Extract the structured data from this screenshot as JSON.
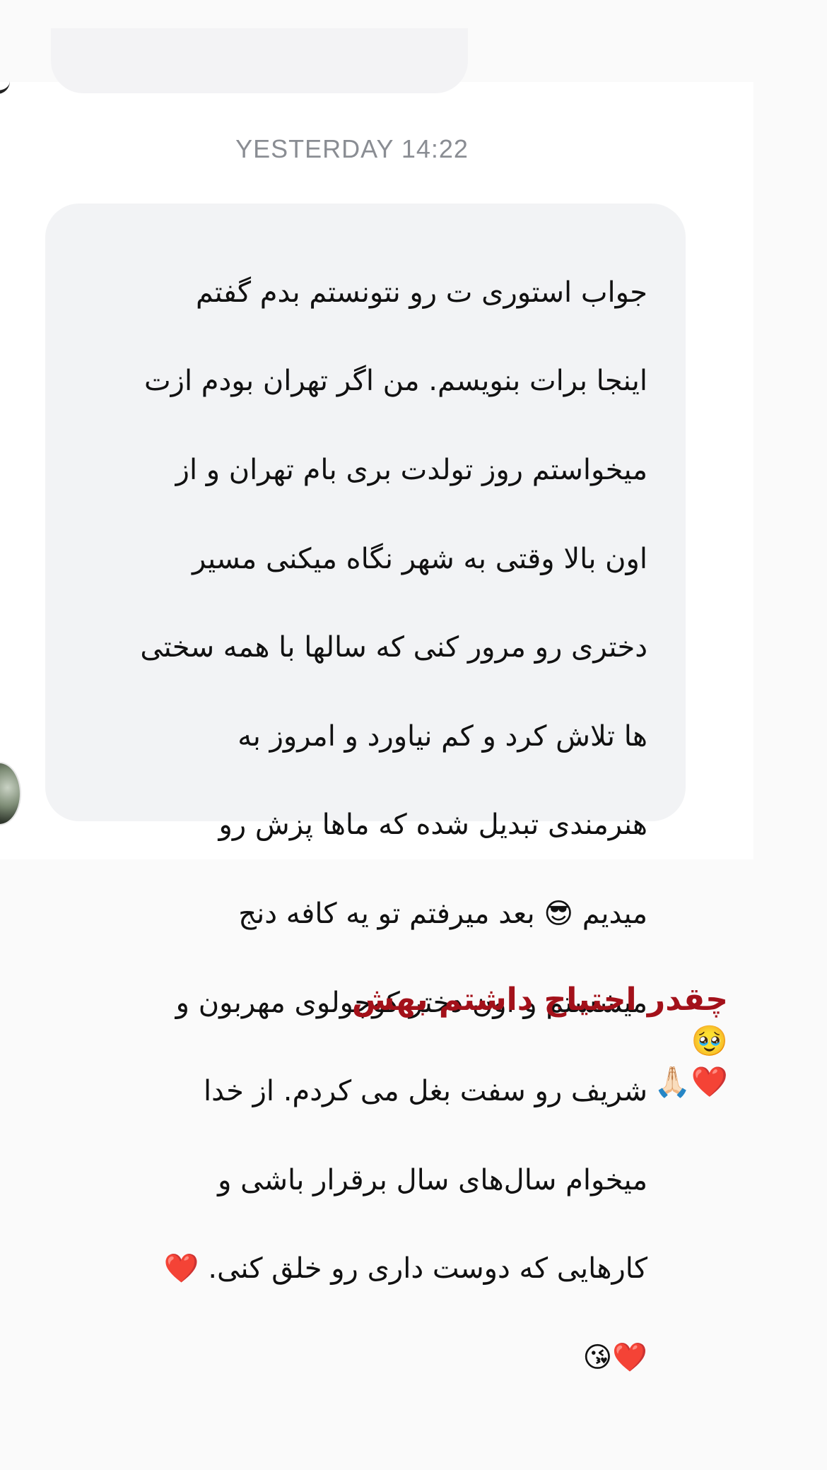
{
  "timestamp": "YESTERDAY 14:22",
  "message": {
    "lines": [
      "جواب استوری ت رو نتونستم بدم گفتم",
      "اینجا برات بنویسم. من اگر تهران بودم ازت",
      "میخواستم روز تولدت بری بام تهران و از",
      "اون بالا وقتی به شهر نگاه میکنی مسیر",
      "دختری رو مرور کنی که سالها با همه سختی",
      "ها تلاش کرد و کم نیاورد و امروز به",
      "هنرمندی تبدیل شده که ماها پزش رو",
      "میدیم 😎 بعد میرفتم تو یه کافه دنج",
      "میشستم و اون دختر کوچولوی مهربون و",
      "شریف رو سفت بغل می کردم. از خدا",
      "میخوام سال‌های سال برقرار باشی و",
      "کارهایی که دوست داری رو خلق کنی. ❤️",
      "❤️😘"
    ]
  },
  "caption": {
    "text": "چقدر احتیاج داشتم بهش",
    "emoji_line1": "🥹",
    "emoji_line2": "❤️🙏🏻"
  },
  "colors": {
    "page_background": "#fafafa",
    "chat_background": "#ffffff",
    "bubble_background": "#f2f3f5",
    "timestamp_text": "#8a8d93",
    "caption_text": "#a3111a"
  }
}
